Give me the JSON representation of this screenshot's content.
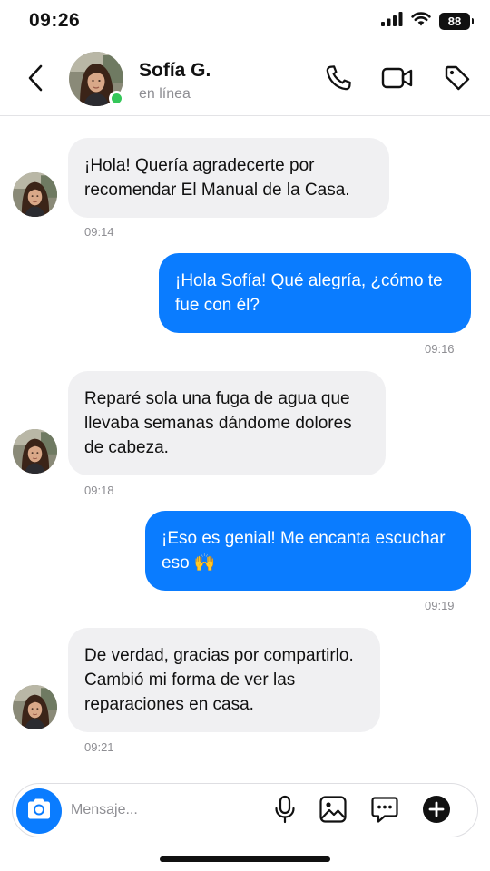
{
  "status_bar": {
    "time": "09:26",
    "battery": "88"
  },
  "header": {
    "contact_name": "Sofía G.",
    "contact_status": "en línea",
    "icons": {
      "back": "chevron-left-icon",
      "call": "phone-icon",
      "video": "video-camera-icon",
      "label": "tag-icon"
    }
  },
  "messages": [
    {
      "direction": "incoming",
      "text": "¡Hola! Quería agradecerte por recomendar El Manual de la Casa.",
      "time": "09:14"
    },
    {
      "direction": "outgoing",
      "text": "¡Hola Sofía! Qué alegría, ¿cómo te fue con él?",
      "time": "09:16"
    },
    {
      "direction": "incoming",
      "text": "Reparé sola una fuga de agua que llevaba semanas dándome dolores de cabeza.",
      "time": "09:18"
    },
    {
      "direction": "outgoing",
      "text": "¡Eso es genial! Me encanta escuchar eso 🙌",
      "time": "09:19"
    },
    {
      "direction": "incoming",
      "text": "De verdad, gracias por compartirlo. Cambió mi forma de ver las reparaciones en casa.",
      "time": "09:21"
    }
  ],
  "composer": {
    "placeholder": "Mensaje...",
    "icons": {
      "camera": "camera-icon",
      "mic": "microphone-icon",
      "gallery": "image-icon",
      "sticker": "chat-bubble-icon",
      "more": "plus-circle-icon"
    }
  },
  "colors": {
    "outgoing_bubble": "#0a7cff",
    "incoming_bubble": "#f0f0f2",
    "online": "#34c759",
    "timestamp": "#8e8e93"
  }
}
